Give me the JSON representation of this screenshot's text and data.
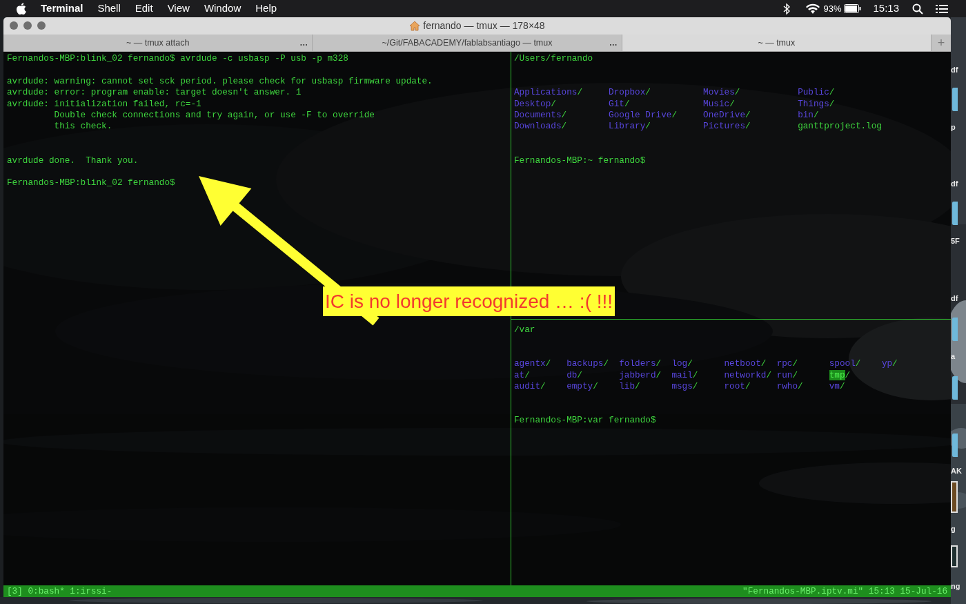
{
  "menu_bar": {
    "app": "Terminal",
    "menus": [
      "Shell",
      "Edit",
      "View",
      "Window",
      "Help"
    ],
    "battery": "93%",
    "clock": "15:13"
  },
  "window": {
    "title": "fernando — tmux — 178×48",
    "tabs": [
      {
        "label": "~ — tmux attach",
        "more": "…",
        "selected": false
      },
      {
        "label": "~/Git/FABACADEMY/fablabsantiago — tmux",
        "more": "…",
        "selected": false
      },
      {
        "label": "~ — tmux",
        "selected": true
      }
    ],
    "new_tab": "+"
  },
  "panes": [
    {
      "content": [
        {
          "kind": "text",
          "text": "Fernandos-MBP:blink_02 fernando$ avrdude -c usbasp -P usb -p m328"
        },
        {
          "kind": "blank"
        },
        {
          "kind": "text",
          "text": "avrdude: warning: cannot set sck period. please check for usbasp firmware update."
        },
        {
          "kind": "text",
          "text": "avrdude: error: program enable: target doesn't answer. 1"
        },
        {
          "kind": "text",
          "text": "avrdude: initialization failed, rc=-1"
        },
        {
          "kind": "text",
          "text": "         Double check connections and try again, or use -F to override"
        },
        {
          "kind": "text",
          "text": "         this check."
        },
        {
          "kind": "blank"
        },
        {
          "kind": "blank"
        },
        {
          "kind": "text",
          "text": "avrdude done.  Thank you."
        },
        {
          "kind": "blank"
        },
        {
          "kind": "text",
          "text": "Fernandos-MBP:blink_02 fernando$"
        }
      ]
    },
    {
      "content": [
        {
          "kind": "text",
          "text": "/Users/fernando"
        },
        {
          "kind": "blank"
        },
        {
          "kind": "blank"
        },
        {
          "kind": "listing",
          "rows": [
            [
              {
                "name": "Applications",
                "suffix": "/",
                "kind": "dir",
                "highlighted": false
              },
              {
                "name": "Dropbox",
                "suffix": "/",
                "kind": "dir",
                "highlighted": false
              },
              {
                "name": "Movies",
                "suffix": "/",
                "kind": "dir",
                "highlighted": false
              },
              {
                "name": "Public",
                "suffix": "/",
                "kind": "dir",
                "highlighted": false
              }
            ],
            [
              {
                "name": "Desktop",
                "suffix": "/",
                "kind": "dir",
                "highlighted": false
              },
              {
                "name": "Git",
                "suffix": "/",
                "kind": "dir",
                "highlighted": false
              },
              {
                "name": "Music",
                "suffix": "/",
                "kind": "dir",
                "highlighted": false
              },
              {
                "name": "Things",
                "suffix": "/",
                "kind": "dir",
                "highlighted": false
              }
            ],
            [
              {
                "name": "Documents",
                "suffix": "/",
                "kind": "dir",
                "highlighted": false
              },
              {
                "name": "Google Drive",
                "suffix": "/",
                "kind": "dir",
                "highlighted": false
              },
              {
                "name": "OneDrive",
                "suffix": "/",
                "kind": "dir",
                "highlighted": false
              },
              {
                "name": "bin",
                "suffix": "/",
                "kind": "dir",
                "highlighted": false
              }
            ],
            [
              {
                "name": "Downloads",
                "suffix": "/",
                "kind": "dir",
                "highlighted": false
              },
              {
                "name": "Library",
                "suffix": "/",
                "kind": "dir",
                "highlighted": false
              },
              {
                "name": "Pictures",
                "suffix": "/",
                "kind": "dir",
                "highlighted": false
              },
              {
                "name": "ganttproject.log",
                "kind": "file",
                "highlighted": false
              }
            ]
          ]
        },
        {
          "kind": "blank"
        },
        {
          "kind": "blank"
        },
        {
          "kind": "text",
          "text": "Fernandos-MBP:~ fernando$"
        }
      ]
    },
    {
      "content": [
        {
          "kind": "text",
          "text": "/var"
        },
        {
          "kind": "blank"
        },
        {
          "kind": "blank"
        },
        {
          "kind": "listing",
          "rows": [
            [
              {
                "name": "agentx",
                "suffix": "/",
                "kind": "dir",
                "highlighted": false
              },
              {
                "name": "backups",
                "suffix": "/",
                "kind": "dir",
                "highlighted": false
              },
              {
                "name": "folders",
                "suffix": "/",
                "kind": "dir",
                "highlighted": false
              },
              {
                "name": "log",
                "suffix": "/",
                "kind": "dir",
                "highlighted": false
              },
              {
                "name": "netboot",
                "suffix": "/",
                "kind": "dir",
                "highlighted": false
              },
              {
                "name": "rpc",
                "suffix": "/",
                "kind": "dir",
                "highlighted": false
              },
              {
                "name": "spool",
                "suffix": "/",
                "kind": "dir",
                "highlighted": false
              },
              {
                "name": "yp",
                "suffix": "/",
                "kind": "dir",
                "highlighted": false
              }
            ],
            [
              {
                "name": "at",
                "suffix": "/",
                "kind": "dir",
                "highlighted": false
              },
              {
                "name": "db",
                "suffix": "/",
                "kind": "dir",
                "highlighted": false
              },
              {
                "name": "jabberd",
                "suffix": "/",
                "kind": "dir",
                "highlighted": false
              },
              {
                "name": "mail",
                "suffix": "/",
                "kind": "dir",
                "highlighted": false
              },
              {
                "name": "networkd",
                "suffix": "/",
                "kind": "dir",
                "highlighted": false
              },
              {
                "name": "run",
                "suffix": "/",
                "kind": "dir",
                "highlighted": false
              },
              {
                "name": "tmp",
                "suffix": "/",
                "kind": "dir",
                "highlighted": true
              }
            ],
            [
              {
                "name": "audit",
                "suffix": "/",
                "kind": "dir",
                "highlighted": false
              },
              {
                "name": "empty",
                "suffix": "/",
                "kind": "dir",
                "highlighted": false
              },
              {
                "name": "lib",
                "suffix": "/",
                "kind": "dir",
                "highlighted": false
              },
              {
                "name": "msgs",
                "suffix": "/",
                "kind": "dir",
                "highlighted": false
              },
              {
                "name": "root",
                "suffix": "/",
                "kind": "dir",
                "highlighted": false
              },
              {
                "name": "rwho",
                "suffix": "/",
                "kind": "dir",
                "highlighted": false
              },
              {
                "name": "vm",
                "suffix": "/",
                "kind": "dir",
                "highlighted": false
              }
            ]
          ]
        },
        {
          "kind": "blank"
        },
        {
          "kind": "blank"
        },
        {
          "kind": "text",
          "text": "Fernandos-MBP:var fernando$"
        }
      ]
    }
  ],
  "status_bar": {
    "left": "[3] 0:bash* 1:irssi-",
    "right": "\"Fernandos-MBP.iptv.mi\" 15:13 15-Jul-16"
  },
  "annotation": {
    "text": "IC is no longer recognized … :( !!!"
  },
  "desktop_labels": [
    "df",
    "p",
    "df",
    "5F",
    "df",
    "a",
    "AK",
    "g",
    "ng"
  ]
}
